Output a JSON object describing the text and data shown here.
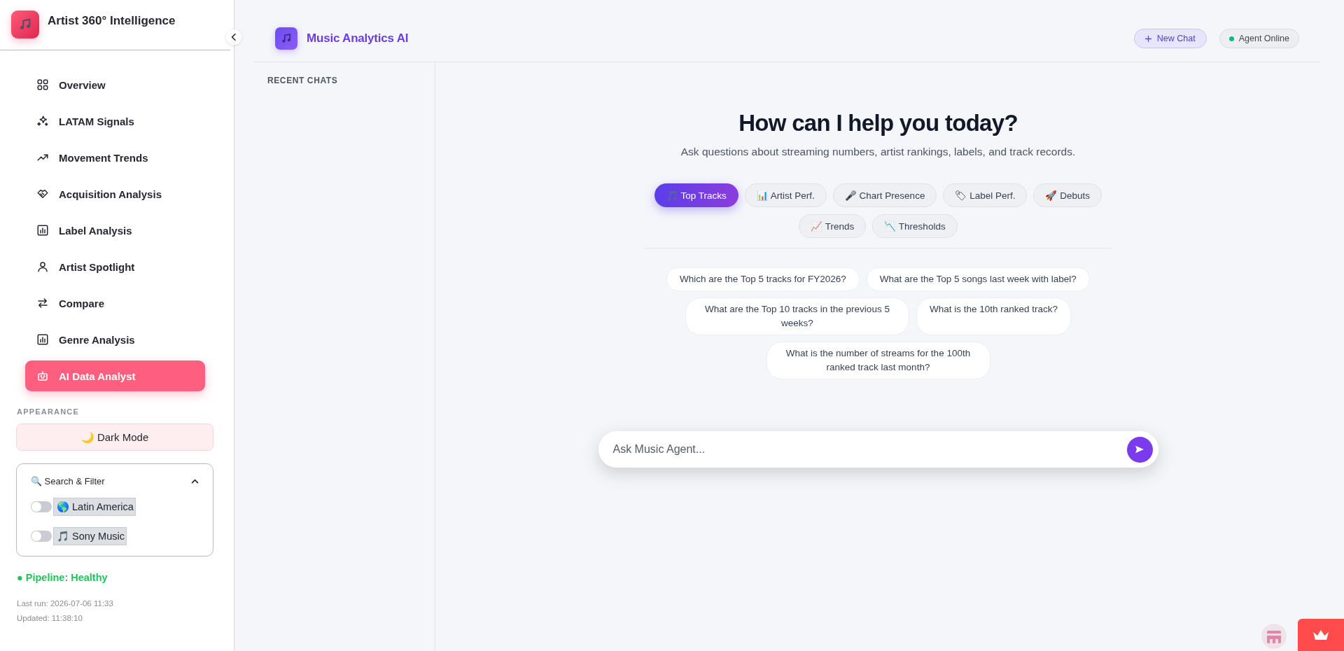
{
  "sidebar": {
    "title": "Artist 360° Intelligence",
    "nav": [
      {
        "label": "Overview",
        "selected": false
      },
      {
        "label": "LATAM Signals",
        "selected": false
      },
      {
        "label": "Movement Trends",
        "selected": false
      },
      {
        "label": "Acquisition Analysis",
        "selected": false
      },
      {
        "label": "Label Analysis",
        "selected": false
      },
      {
        "label": "Artist Spotlight",
        "selected": false
      },
      {
        "label": "Compare",
        "selected": false
      },
      {
        "label": "Genre Analysis",
        "selected": false
      },
      {
        "label": "AI Data Analyst",
        "selected": true
      }
    ],
    "appearance": {
      "heading": "APPEARANCE",
      "dark_mode_button": "🌙 Dark Mode"
    },
    "filter_panel": {
      "title": "🔍 Search & Filter",
      "expanded": true,
      "toggles": [
        {
          "label": "🌎 Latin America",
          "on": false
        },
        {
          "label": "🎵 Sony Music",
          "on": false
        }
      ]
    },
    "status": {
      "pipeline": "● Pipeline: Healthy",
      "last_run": "Last run: 2026-07-06 11:33",
      "updated": "Updated: 11:38:10"
    }
  },
  "header": {
    "title": "Music Analytics AI",
    "new_chat_button": "New Chat",
    "agent_status": {
      "label": "Agent Online",
      "online": true
    }
  },
  "recent_chats": {
    "heading": "RECENT CHATS"
  },
  "welcome": {
    "heading": "How can I help you today?",
    "subtitle": "Ask questions about streaming numbers, artist rankings, labels, and track records."
  },
  "categories": [
    {
      "label": "🎵 Top Tracks",
      "selected": true
    },
    {
      "label": "📊 Artist Perf.",
      "selected": false
    },
    {
      "label": "🎤 Chart Presence",
      "selected": false
    },
    {
      "label": "🏷 Label Perf.",
      "selected": false
    },
    {
      "label": "🚀 Debuts",
      "selected": false
    },
    {
      "label": "📈 Trends",
      "selected": false
    },
    {
      "label": "📉 Thresholds",
      "selected": false
    }
  ],
  "suggestions": [
    "Which are the Top 5 tracks for FY2026?",
    "What are the Top 5 songs last week with label?",
    "What are the Top 10 tracks in the previous 5 weeks?",
    "What is the 10th ranked track?",
    "What is the number of streams for the 100th ranked track last month?"
  ],
  "composer": {
    "placeholder": "Ask Music Agent..."
  }
}
